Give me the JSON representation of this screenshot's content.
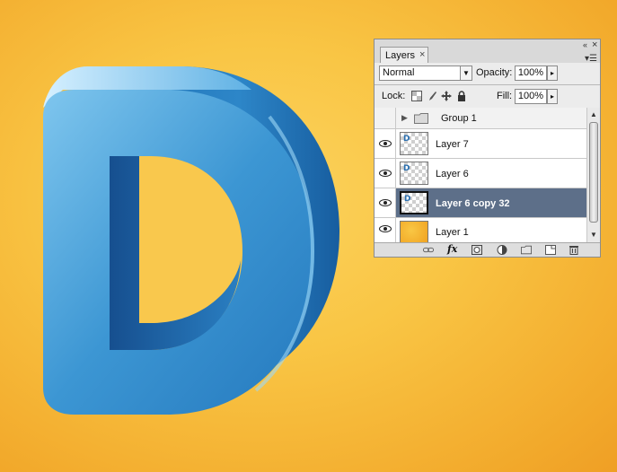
{
  "panel": {
    "tab_label": "Layers",
    "tab_close": "×",
    "collapse_glyph": "«",
    "close_glyph": "×",
    "menu_glyph": "▾☰"
  },
  "blend": {
    "mode": "Normal",
    "opacity_label": "Opacity:",
    "opacity_value": "100%"
  },
  "lock": {
    "label": "Lock:",
    "fill_label": "Fill:",
    "fill_value": "100%"
  },
  "layers": [
    {
      "name": "Group 1",
      "visible": false,
      "type": "group"
    },
    {
      "name": "Layer 7",
      "visible": true,
      "type": "layer"
    },
    {
      "name": "Layer 6",
      "visible": true,
      "type": "layer"
    },
    {
      "name": "Layer 6 copy 32",
      "visible": true,
      "type": "layer",
      "selected": true
    },
    {
      "name": "Layer 1",
      "visible": true,
      "type": "fill"
    }
  ],
  "thumb_letter": "D",
  "colors": {
    "background": "#f9c544",
    "letter_blue": "#2f86c8",
    "selection": "#5d6f89"
  }
}
